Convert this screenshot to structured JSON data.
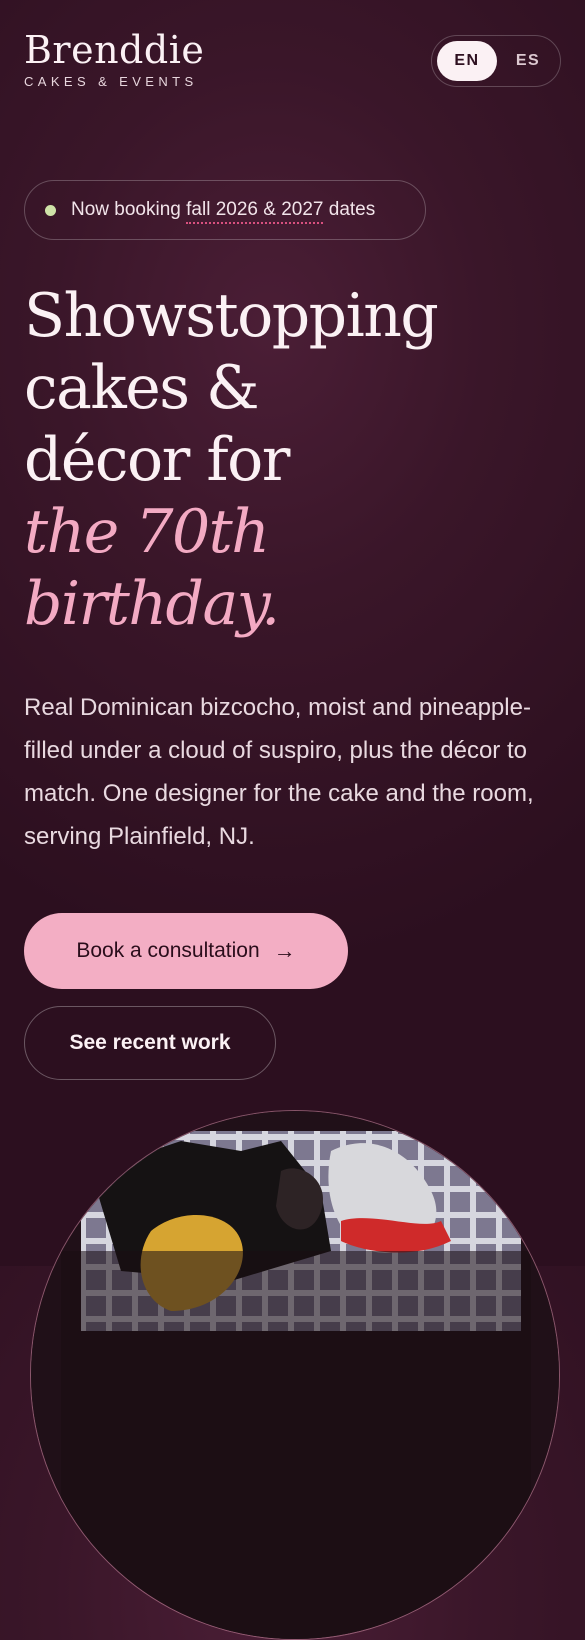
{
  "brand": {
    "name": "Brenddie",
    "tagline": "CAKES & EVENTS"
  },
  "language": {
    "options": [
      "EN",
      "ES"
    ],
    "selected": "EN"
  },
  "booking": {
    "prefix": "Now booking ",
    "dates": "fall 2026 & 2027",
    "suffix": " dates"
  },
  "hero": {
    "headline_lines": [
      "Showstopping",
      "cakes &",
      "décor for"
    ],
    "headline_accent_lines": [
      "the 70th",
      "birthday."
    ],
    "intro": "Real Dominican bizcocho, moist and pineapple-filled under a cloud of suspiro, plus the décor to match. One designer for the cake and the room, serving Plainfield, NJ."
  },
  "actions": {
    "primary_label": "Book a consultation",
    "primary_icon": "arrow-right-icon",
    "secondary_label": "See recent work"
  },
  "colors": {
    "background": "#3a1629",
    "accent_pink": "#f3aac3",
    "status_dot": "#cfe3a8",
    "text": "#fbf1f4"
  }
}
